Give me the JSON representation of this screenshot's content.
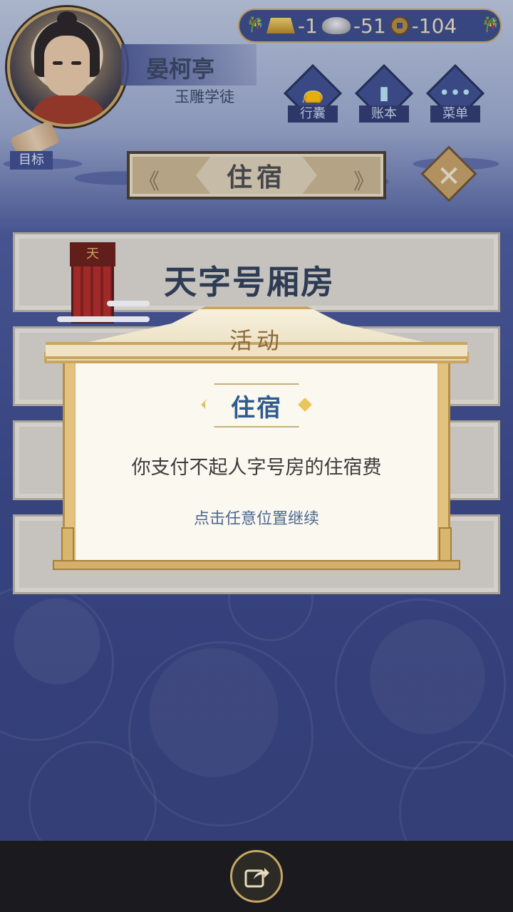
{
  "player": {
    "name": "晏柯亭",
    "title": "玉雕学徒"
  },
  "currency": {
    "gold": "-1",
    "silver": "-51",
    "coins": "-104"
  },
  "menu": {
    "bag_label": "行囊",
    "ledger_label": "账本",
    "menu_label": "菜单"
  },
  "goal_label": "目标",
  "screen_title": "住宿",
  "rooms": {
    "first_room_name": "天字号厢房",
    "first_room_sign": "天"
  },
  "dialog": {
    "header": "活动",
    "tag": "住宿",
    "message": "你支付不起人字号房的住宿费",
    "hint": "点击任意位置继续"
  },
  "colors": {
    "dialog_tag_text": "#2e5b8f",
    "currency_bg": "#3b4a84",
    "gold_trim": "#c8a75a"
  }
}
